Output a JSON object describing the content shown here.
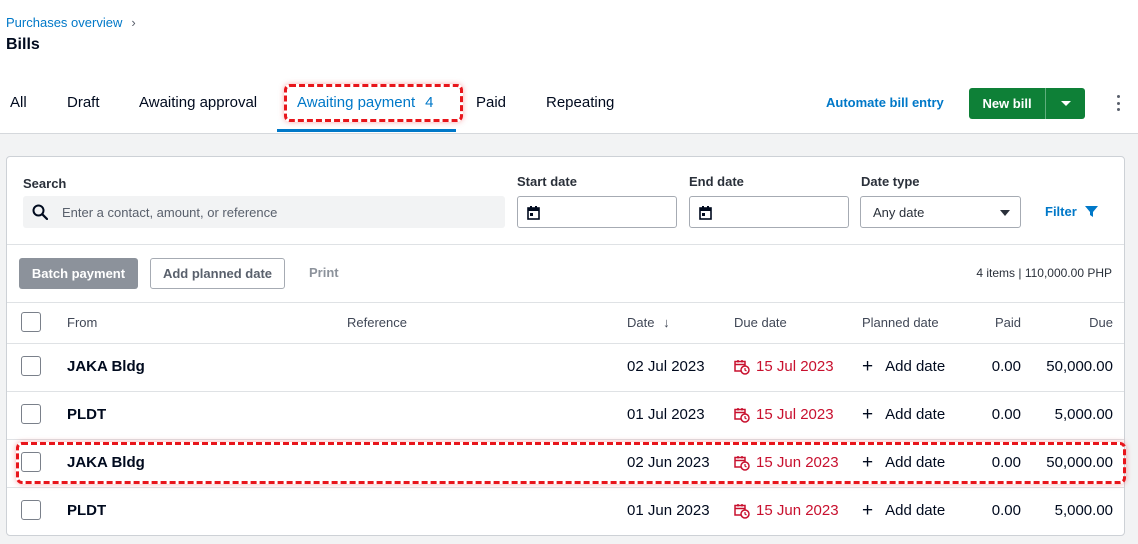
{
  "header": {
    "breadcrumb": "Purchases overview",
    "breadcrumb_separator": "›",
    "title": "Bills"
  },
  "tabs": [
    {
      "label": "All"
    },
    {
      "label": "Draft"
    },
    {
      "label": "Awaiting approval"
    },
    {
      "label": "Awaiting payment",
      "count": "4",
      "active": true
    },
    {
      "label": "Paid"
    },
    {
      "label": "Repeating"
    }
  ],
  "actions": {
    "automate_label": "Automate bill entry",
    "new_bill_label": "New bill"
  },
  "filters": {
    "search_label": "Search",
    "search_placeholder": "Enter a contact, amount, or reference",
    "start_date_label": "Start date",
    "end_date_label": "End date",
    "date_type_label": "Date type",
    "date_type_value": "Any date",
    "filter_label": "Filter"
  },
  "toolbar": {
    "batch_payment_label": "Batch payment",
    "add_planned_date_label": "Add planned date",
    "print_label": "Print",
    "summary": "4 items | 110,000.00 PHP"
  },
  "table": {
    "columns": {
      "from": "From",
      "reference": "Reference",
      "date": "Date",
      "date_sort": "↓",
      "due_date": "Due date",
      "planned_date": "Planned date",
      "paid": "Paid",
      "due": "Due"
    },
    "rows": [
      {
        "from": "JAKA Bldg",
        "reference": "",
        "date": "02 Jul 2023",
        "due_date": "15 Jul 2023",
        "planned_date": "Add date",
        "paid": "0.00",
        "due": "50,000.00"
      },
      {
        "from": "PLDT",
        "reference": "",
        "date": "01 Jul 2023",
        "due_date": "15 Jul 2023",
        "planned_date": "Add date",
        "paid": "0.00",
        "due": "5,000.00"
      },
      {
        "from": "JAKA Bldg",
        "reference": "",
        "date": "02 Jun 2023",
        "due_date": "15 Jun 2023",
        "planned_date": "Add date",
        "paid": "0.00",
        "due": "50,000.00"
      },
      {
        "from": "PLDT",
        "reference": "",
        "date": "01 Jun 2023",
        "due_date": "15 Jun 2023",
        "planned_date": "Add date",
        "paid": "0.00",
        "due": "5,000.00"
      }
    ]
  },
  "colors": {
    "brand_blue": "#0078c8",
    "new_bill_green": "#0e8037",
    "overdue_red": "#c8102e",
    "annotation_red": "#e8151b"
  }
}
